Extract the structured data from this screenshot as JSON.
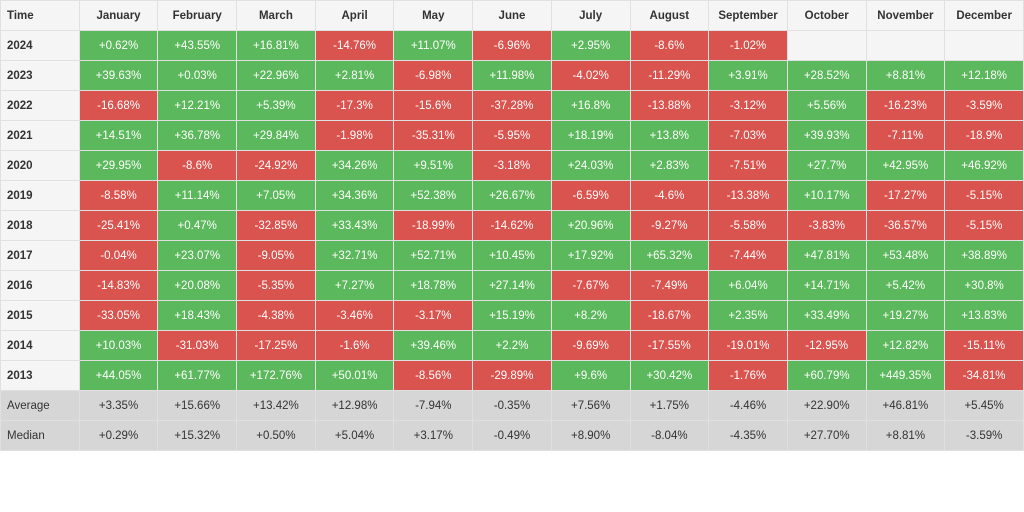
{
  "headers": [
    "Time",
    "January",
    "February",
    "March",
    "April",
    "May",
    "June",
    "July",
    "August",
    "September",
    "October",
    "November",
    "December"
  ],
  "rows": [
    {
      "year": "2024",
      "cells": [
        "+0.62%",
        "+43.55%",
        "+16.81%",
        "-14.76%",
        "+11.07%",
        "-6.96%",
        "+2.95%",
        "-8.6%",
        "-1.02%",
        "",
        "",
        ""
      ]
    },
    {
      "year": "2023",
      "cells": [
        "+39.63%",
        "+0.03%",
        "+22.96%",
        "+2.81%",
        "-6.98%",
        "+11.98%",
        "-4.02%",
        "-11.29%",
        "+3.91%",
        "+28.52%",
        "+8.81%",
        "+12.18%"
      ]
    },
    {
      "year": "2022",
      "cells": [
        "-16.68%",
        "+12.21%",
        "+5.39%",
        "-17.3%",
        "-15.6%",
        "-37.28%",
        "+16.8%",
        "-13.88%",
        "-3.12%",
        "+5.56%",
        "-16.23%",
        "-3.59%"
      ]
    },
    {
      "year": "2021",
      "cells": [
        "+14.51%",
        "+36.78%",
        "+29.84%",
        "-1.98%",
        "-35.31%",
        "-5.95%",
        "+18.19%",
        "+13.8%",
        "-7.03%",
        "+39.93%",
        "-7.11%",
        "-18.9%"
      ]
    },
    {
      "year": "2020",
      "cells": [
        "+29.95%",
        "-8.6%",
        "-24.92%",
        "+34.26%",
        "+9.51%",
        "-3.18%",
        "+24.03%",
        "+2.83%",
        "-7.51%",
        "+27.7%",
        "+42.95%",
        "+46.92%"
      ]
    },
    {
      "year": "2019",
      "cells": [
        "-8.58%",
        "+11.14%",
        "+7.05%",
        "+34.36%",
        "+52.38%",
        "+26.67%",
        "-6.59%",
        "-4.6%",
        "-13.38%",
        "+10.17%",
        "-17.27%",
        "-5.15%"
      ]
    },
    {
      "year": "2018",
      "cells": [
        "-25.41%",
        "+0.47%",
        "-32.85%",
        "+33.43%",
        "-18.99%",
        "-14.62%",
        "+20.96%",
        "-9.27%",
        "-5.58%",
        "-3.83%",
        "-36.57%",
        "-5.15%"
      ]
    },
    {
      "year": "2017",
      "cells": [
        "-0.04%",
        "+23.07%",
        "-9.05%",
        "+32.71%",
        "+52.71%",
        "+10.45%",
        "+17.92%",
        "+65.32%",
        "-7.44%",
        "+47.81%",
        "+53.48%",
        "+38.89%"
      ]
    },
    {
      "year": "2016",
      "cells": [
        "-14.83%",
        "+20.08%",
        "-5.35%",
        "+7.27%",
        "+18.78%",
        "+27.14%",
        "-7.67%",
        "-7.49%",
        "+6.04%",
        "+14.71%",
        "+5.42%",
        "+30.8%"
      ]
    },
    {
      "year": "2015",
      "cells": [
        "-33.05%",
        "+18.43%",
        "-4.38%",
        "-3.46%",
        "-3.17%",
        "+15.19%",
        "+8.2%",
        "-18.67%",
        "+2.35%",
        "+33.49%",
        "+19.27%",
        "+13.83%"
      ]
    },
    {
      "year": "2014",
      "cells": [
        "+10.03%",
        "-31.03%",
        "-17.25%",
        "-1.6%",
        "+39.46%",
        "+2.2%",
        "-9.69%",
        "-17.55%",
        "-19.01%",
        "-12.95%",
        "+12.82%",
        "-15.11%"
      ]
    },
    {
      "year": "2013",
      "cells": [
        "+44.05%",
        "+61.77%",
        "+172.76%",
        "+50.01%",
        "-8.56%",
        "-29.89%",
        "+9.6%",
        "+30.42%",
        "-1.76%",
        "+60.79%",
        "+449.35%",
        "-34.81%"
      ]
    }
  ],
  "average": {
    "label": "Average",
    "cells": [
      "+3.35%",
      "+15.66%",
      "+13.42%",
      "+12.98%",
      "-7.94%",
      "-0.35%",
      "+7.56%",
      "+1.75%",
      "-4.46%",
      "+22.90%",
      "+46.81%",
      "+5.45%"
    ]
  },
  "median": {
    "label": "Median",
    "cells": [
      "+0.29%",
      "+15.32%",
      "+0.50%",
      "+5.04%",
      "+3.17%",
      "-0.49%",
      "+8.90%",
      "-8.04%",
      "-4.35%",
      "+27.70%",
      "+8.81%",
      "-3.59%"
    ]
  }
}
